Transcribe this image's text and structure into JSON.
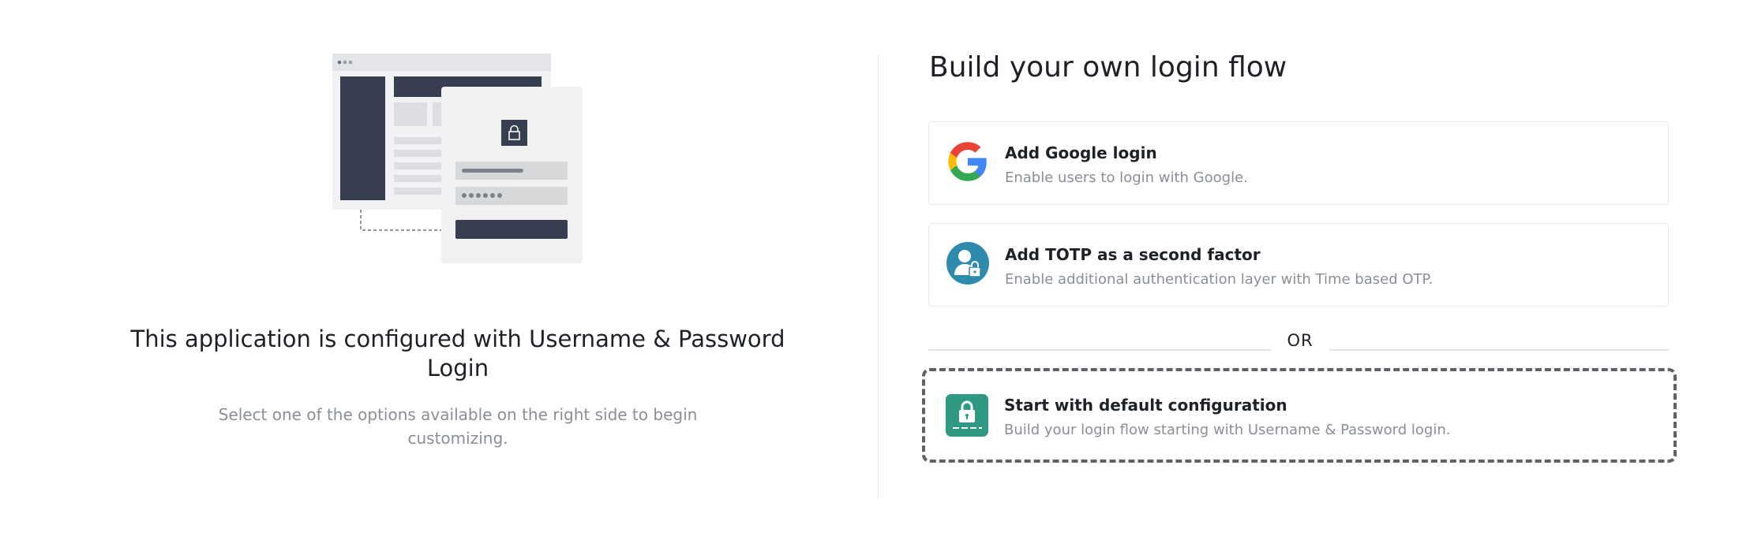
{
  "left": {
    "title": "This application is configured with Username & Password Login",
    "subtitle": "Select one of the options available on the right side to begin customizing."
  },
  "right": {
    "title": "Build your own login flow",
    "options": [
      {
        "title": "Add Google login",
        "description": "Enable users to login with Google.",
        "icon": "google-icon"
      },
      {
        "title": "Add TOTP as a second factor",
        "description": "Enable additional authentication layer with Time based OTP.",
        "icon": "totp-user-lock-icon"
      }
    ],
    "or_label": "OR",
    "default_option": {
      "title": "Start with default configuration",
      "description": "Build your login flow starting with Username & Password login.",
      "icon": "password-lock-icon"
    }
  },
  "colors": {
    "google_blue": "#4285F4",
    "google_red": "#EA4335",
    "google_yellow": "#FBBC05",
    "google_green": "#34A853",
    "totp_teal": "#2e8bae",
    "default_green": "#2f9a83",
    "illustration_dark": "#373e4f"
  }
}
